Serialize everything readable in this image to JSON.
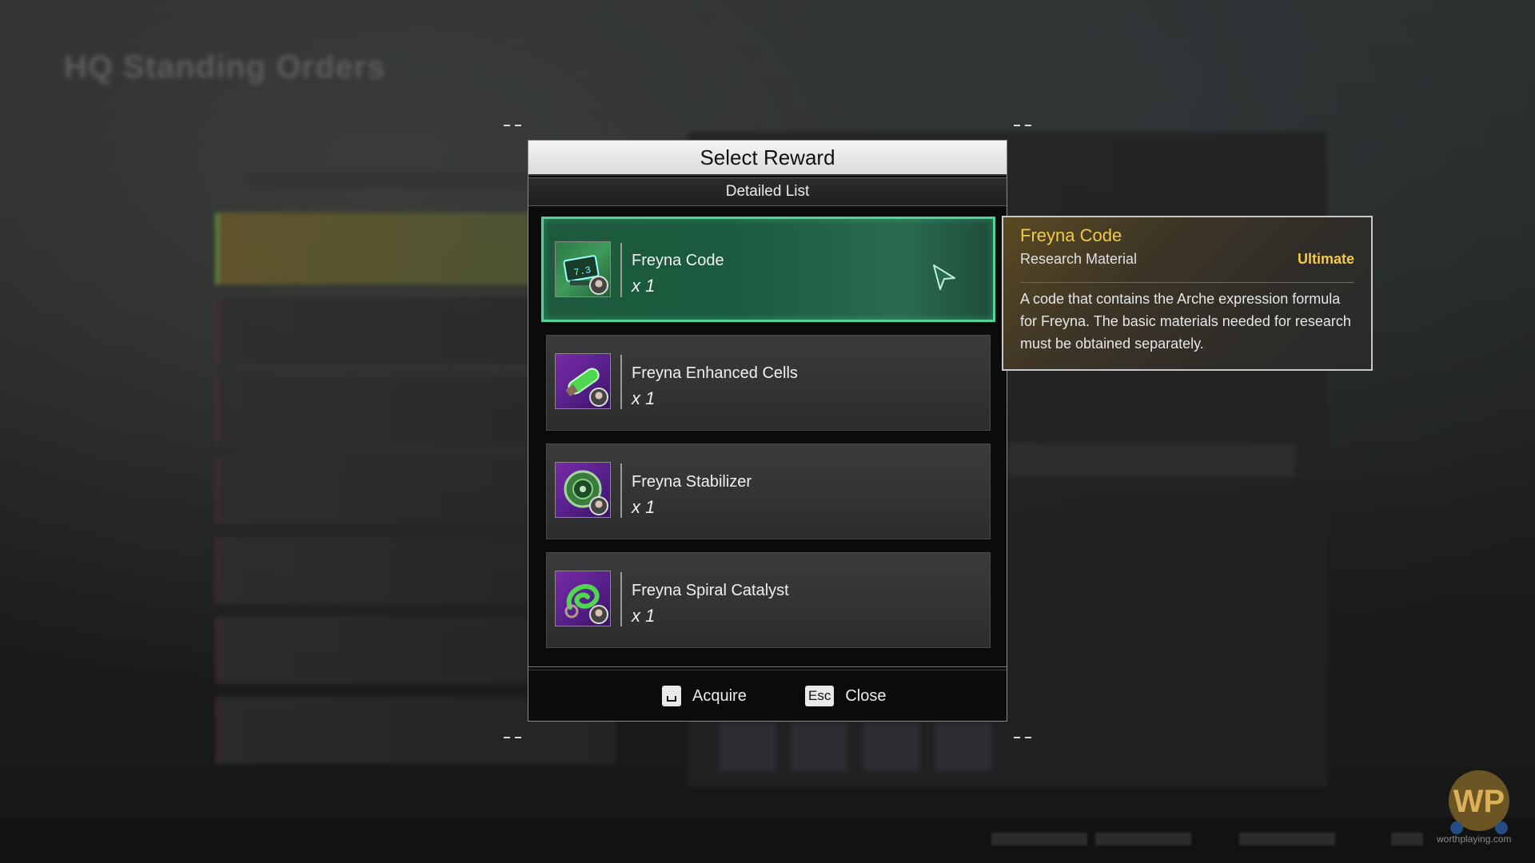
{
  "background": {
    "title": "HQ Standing Orders"
  },
  "dialog": {
    "title": "Select Reward",
    "subtitle": "Detailed List",
    "items": [
      {
        "name": "Freyna Code",
        "qty": "x 1",
        "icon": "code-chip-icon",
        "selected": true
      },
      {
        "name": "Freyna Enhanced Cells",
        "qty": "x 1",
        "icon": "cell-capsule-icon",
        "selected": false
      },
      {
        "name": "Freyna Stabilizer",
        "qty": "x 1",
        "icon": "stabilizer-disc-icon",
        "selected": false
      },
      {
        "name": "Freyna Spiral Catalyst",
        "qty": "x 1",
        "icon": "spiral-catalyst-icon",
        "selected": false
      }
    ],
    "footer": {
      "acquire_label": "Acquire",
      "close_key": "Esc",
      "close_label": "Close"
    }
  },
  "tooltip": {
    "name": "Freyna Code",
    "type": "Research Material",
    "rarity": "Ultimate",
    "description": "A code that contains the Arche expression formula for Freyna. The basic materials needed for research must be obtained separately."
  },
  "watermark": {
    "text": "worthplaying.com"
  },
  "colors": {
    "selected_border": "#52d39a",
    "ultimate": "#f3c94a"
  }
}
